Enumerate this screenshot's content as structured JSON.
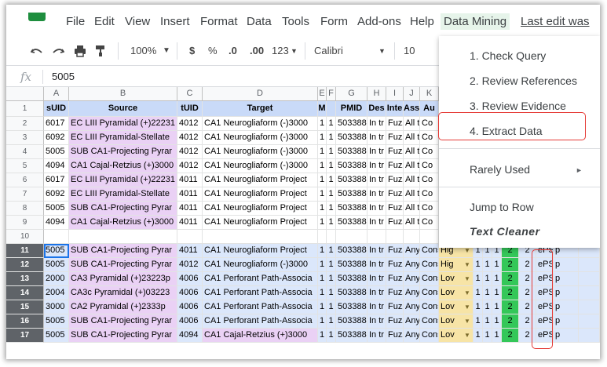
{
  "menubar": {
    "items": [
      "File",
      "Edit",
      "View",
      "Insert",
      "Format",
      "Data",
      "Tools",
      "Form",
      "Add-ons",
      "Help",
      "Data Mining"
    ],
    "last_edit": "Last edit was"
  },
  "toolbar": {
    "zoom": "100%",
    "currency": "$",
    "percent": "%",
    "dec_decrease": ".0",
    "dec_increase": ".00",
    "format_more": "123",
    "font": "Calibri",
    "font_size": "10"
  },
  "formula_bar": {
    "fx": "fx",
    "value": "5005"
  },
  "grid": {
    "columns": [
      "A",
      "B",
      "C",
      "D",
      "E",
      "F",
      "G",
      "H",
      "I",
      "J",
      "K"
    ],
    "header_row": [
      "sUID",
      "Source",
      "tUID",
      "Target",
      "M",
      "",
      "PMID",
      "Des",
      "Inte",
      "Ass",
      "Au"
    ],
    "rows": [
      {
        "n": "2",
        "c": [
          "6017",
          "EC LIII Pyramidal (+)22231",
          "4012",
          "CA1 Neurogliaform (-)3000",
          "1",
          "1",
          "503388",
          "In tr",
          "Fuzz",
          "All t",
          "Co"
        ]
      },
      {
        "n": "3",
        "c": [
          "6092",
          "EC LIII Pyramidal-Stellate",
          "4012",
          "CA1 Neurogliaform (-)3000",
          "1",
          "1",
          "503388",
          "In tr",
          "Fuzz",
          "All t",
          "Co"
        ]
      },
      {
        "n": "4",
        "c": [
          "5005",
          "SUB CA1-Projecting Pyrar",
          "4012",
          "CA1 Neurogliaform (-)3000",
          "1",
          "1",
          "503388",
          "In tr",
          "Fuzz",
          "All t",
          "Co"
        ]
      },
      {
        "n": "5",
        "c": [
          "4094",
          "CA1 Cajal-Retzius (+)3000",
          "4012",
          "CA1 Neurogliaform (-)3000",
          "1",
          "1",
          "503388",
          "In tr",
          "Fuzz",
          "All t",
          "Co"
        ]
      },
      {
        "n": "6",
        "c": [
          "6017",
          "EC LIII Pyramidal (+)22231",
          "4011",
          "CA1 Neurogliaform Project",
          "1",
          "1",
          "503388",
          "In tr",
          "Fuzz",
          "All t",
          "Co"
        ]
      },
      {
        "n": "7",
        "c": [
          "6092",
          "EC LIII Pyramidal-Stellate",
          "4011",
          "CA1 Neurogliaform Project",
          "1",
          "1",
          "503388",
          "In tr",
          "Fuzz",
          "All t",
          "Co"
        ]
      },
      {
        "n": "8",
        "c": [
          "5005",
          "SUB CA1-Projecting Pyrar",
          "4011",
          "CA1 Neurogliaform Project",
          "1",
          "1",
          "503388",
          "In tr",
          "Fuzz",
          "All t",
          "Co"
        ]
      },
      {
        "n": "9",
        "c": [
          "4094",
          "CA1 Cajal-Retzius (+)3000",
          "4011",
          "CA1 Neurogliaform Project",
          "1",
          "1",
          "503388",
          "In tr",
          "Fuzz",
          "All t",
          "Co"
        ]
      },
      {
        "n": "10",
        "c": [
          "",
          "",
          "",
          "",
          "",
          "",
          "",
          "",
          "",
          "",
          ""
        ]
      },
      {
        "n": "11",
        "c": [
          "5005",
          "SUB CA1-Projecting Pyrar",
          "4011",
          "CA1 Neurogliaform Project",
          "1",
          "1",
          "503388",
          "In tr",
          "Fuzz",
          "Any",
          "Cons"
        ],
        "x": [
          "Hig",
          "1",
          "1",
          "1",
          "2",
          "2",
          "ePSC",
          "p"
        ]
      },
      {
        "n": "12",
        "c": [
          "5005",
          "SUB CA1-Projecting Pyrar",
          "4012",
          "CA1 Neurogliaform (-)3000",
          "1",
          "1",
          "503388",
          "In tr",
          "Fuzz",
          "Any",
          "Cons"
        ],
        "x": [
          "Hig",
          "1",
          "1",
          "1",
          "2",
          "2",
          "ePSC",
          "p"
        ]
      },
      {
        "n": "13",
        "c": [
          "2000",
          "CA3 Pyramidal (+)23223p",
          "4006",
          "CA1 Perforant Path-Associa",
          "1",
          "1",
          "503388",
          "In tr",
          "Fuzz",
          "Any",
          "Cons"
        ],
        "x": [
          "Lov",
          "1",
          "1",
          "1",
          "2",
          "2",
          "ePSC",
          "p"
        ]
      },
      {
        "n": "14",
        "c": [
          "2004",
          "CA3c Pyramidal (+)03223",
          "4006",
          "CA1 Perforant Path-Associa",
          "1",
          "1",
          "503388",
          "In tr",
          "Fuzz",
          "Any",
          "Cons"
        ],
        "x": [
          "Lov",
          "1",
          "1",
          "1",
          "2",
          "2",
          "ePSC",
          "p"
        ]
      },
      {
        "n": "15",
        "c": [
          "3000",
          "CA2 Pyramidal (+)2333p",
          "4006",
          "CA1 Perforant Path-Associa",
          "1",
          "1",
          "503388",
          "In tr",
          "Fuzz",
          "Any",
          "Cons"
        ],
        "x": [
          "Lov",
          "1",
          "1",
          "1",
          "2",
          "2",
          "ePSC",
          "p"
        ]
      },
      {
        "n": "16",
        "c": [
          "5005",
          "SUB CA1-Projecting Pyrar",
          "4006",
          "CA1 Perforant Path-Associa",
          "1",
          "1",
          "503388",
          "In tr",
          "Fuzz",
          "Any",
          "Cons"
        ],
        "x": [
          "Lov",
          "1",
          "1",
          "1",
          "2",
          "2",
          "ePSC",
          "p"
        ]
      },
      {
        "n": "17",
        "c": [
          "5005",
          "SUB CA1-Projecting Pyrar",
          "4094",
          "CA1 Cajal-Retzius (+)3000",
          "1",
          "1",
          "503388",
          "In tr",
          "Fuzz",
          "Any",
          "Cons"
        ],
        "x": [
          "Lov",
          "1",
          "1",
          "1",
          "2",
          "2",
          "ePSC",
          "p"
        ]
      }
    ]
  },
  "dropdown": {
    "check_query": "1. Check Query",
    "review_references": "2. Review References",
    "review_evidence": "3. Review Evidence",
    "extract_data": "4. Extract Data",
    "rarely_used": "Rarely Used",
    "jump_to_row": "Jump to Row",
    "text_cleaner": "Text Cleaner"
  },
  "colors": {
    "header_blue": "#c9daf8",
    "source_pink": "#ead1f5",
    "highlight_green": "#34c759",
    "highlight_red": "#e53935",
    "menu_active_bg": "#e6f4ea"
  }
}
